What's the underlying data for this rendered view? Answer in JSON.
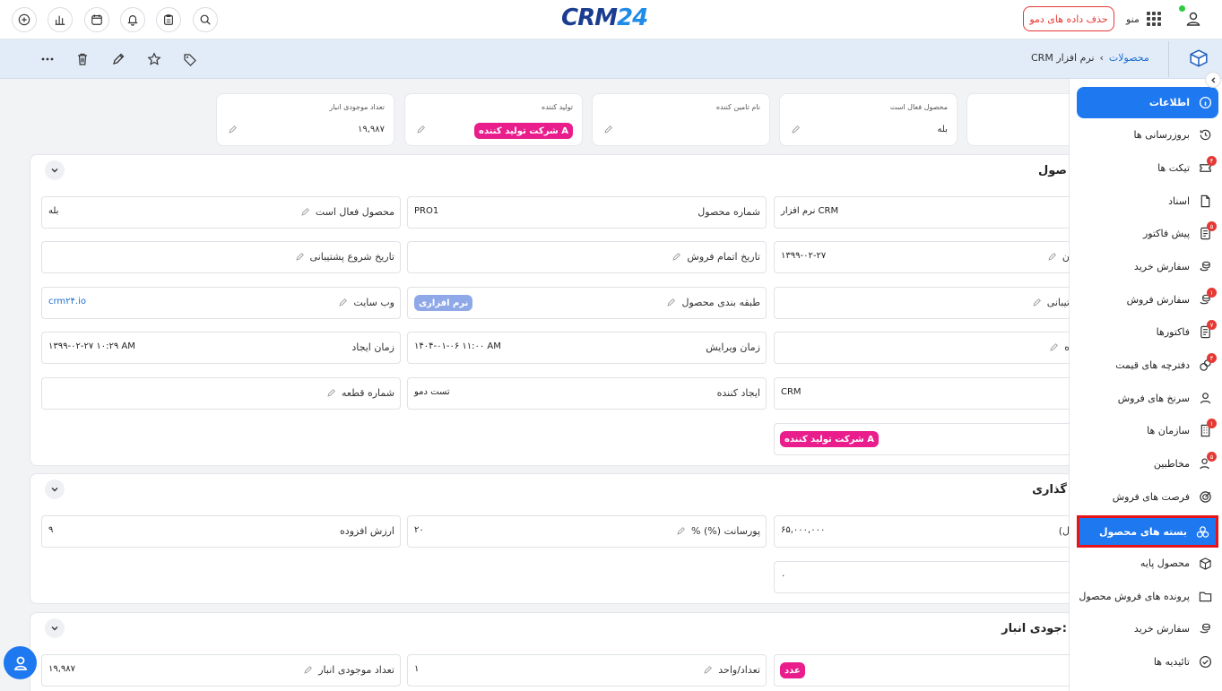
{
  "topbar": {
    "logo_part1": "CRM",
    "logo_part2": "24",
    "demo_button": "حذف داده های دمو",
    "menu_label": "منو"
  },
  "breadcrumb": {
    "parent": "محصولات",
    "separator": "›",
    "current": "نرم افزار CRM"
  },
  "summary_cards": [
    {
      "label": "تعداد موجودی انبار",
      "value": "۱۹,۹۸۷"
    },
    {
      "label": "تولید کننده",
      "tag": "شرکت تولید کننده A"
    },
    {
      "label": "نام تامین کننده",
      "value": ""
    },
    {
      "label": "محصول فعال است",
      "value": "بله"
    }
  ],
  "section1": {
    "title": "صول",
    "fields": {
      "active_label": "محصول فعال است",
      "active_value": "بله",
      "product_number_label": "شماره محصول",
      "product_number_value": "PRO1",
      "name_value": "نرم افزار CRM",
      "support_start_label": "تاریخ شروع پشتیبانی",
      "sales_end_label": "تاریخ اتمام فروش",
      "date_value": "۱۳۹۹-۰۲-۲۷",
      "partial_label_1": "ن",
      "website_label": "وب سایت",
      "website_value": "crm۲۴.io",
      "category_label": "طبقه بندی محصول",
      "category_tag": "نرم افزاری",
      "support_partial_label": "تیبانی",
      "created_label": "زمان ایجاد",
      "created_value": "۱۳۹۹-۰۲-۲۷ ۱۰:۲۹ AM",
      "modified_label": "زمان ویرایش",
      "modified_value": "۱۴۰۴-۰۱-۰۶ ۱۱:۰۰ AM",
      "partial_label_2": "ه",
      "part_number_label": "شماره قطعه",
      "creator_label": "ایجاد کننده",
      "creator_value": "تست دمو",
      "crm_value": "CRM",
      "manufacturer_tag": "شرکت تولید کننده A"
    }
  },
  "section2": {
    "title": "گذاری",
    "fields": {
      "vat_label": "ارزش افزوده",
      "vat_value": "۹",
      "commission_label": "پورسانت (%)  %",
      "commission_value": "۲۰",
      "price_value": "۶۵,۰۰۰,۰۰۰",
      "price_partial_label": "ل)",
      "zero_value": "۰"
    }
  },
  "section3": {
    "title": "جودی انبار:",
    "fields": {
      "stock_label": "تعداد موجودی انبار",
      "stock_value": "۱۹,۹۸۷",
      "qty_unit_label": "تعداد/واحد",
      "qty_unit_value": "۱",
      "unit_tag": "عدد"
    }
  },
  "sidebar": {
    "items": [
      {
        "label": "اطلاعات",
        "icon": "info-icon"
      },
      {
        "label": "بروزرسانی ها",
        "icon": "history-icon"
      },
      {
        "label": "تیکت ها",
        "icon": "ticket-icon",
        "badge": "۴"
      },
      {
        "label": "اسناد",
        "icon": "document-icon"
      },
      {
        "label": "پیش فاکتور",
        "icon": "invoice-icon",
        "badge": "۵"
      },
      {
        "label": "سفارش خرید",
        "icon": "coins-icon"
      },
      {
        "label": "سفارش فروش",
        "icon": "coins-icon",
        "badge": "۱"
      },
      {
        "label": "فاکتورها",
        "icon": "invoice-icon",
        "badge": "۷"
      },
      {
        "label": "دفترچه های قیمت",
        "icon": "price-book-icon",
        "badge": "۴"
      },
      {
        "label": "سرنخ های فروش",
        "icon": "lead-icon"
      },
      {
        "label": "سازمان ها",
        "icon": "building-icon",
        "badge": "۱"
      },
      {
        "label": "مخاطبین",
        "icon": "contacts-icon",
        "badge": "۵"
      },
      {
        "label": "فرصت های فروش",
        "icon": "target-icon"
      },
      {
        "label": "بسته های محصول",
        "icon": "bundle-icon"
      },
      {
        "label": "محصول پایه",
        "icon": "box-icon"
      },
      {
        "label": "پرونده های فروش محصول",
        "icon": "folder-icon"
      },
      {
        "label": "سفارش خرید",
        "icon": "coins-icon"
      },
      {
        "label": "تائیدیه ها",
        "icon": "check-circle-icon"
      }
    ]
  },
  "colors": {
    "accent": "#1e78f0",
    "tag_pink": "#e91e8c",
    "tag_blue": "#8fa9e8",
    "danger": "#e53935",
    "highlight_border": "#e5141a"
  }
}
